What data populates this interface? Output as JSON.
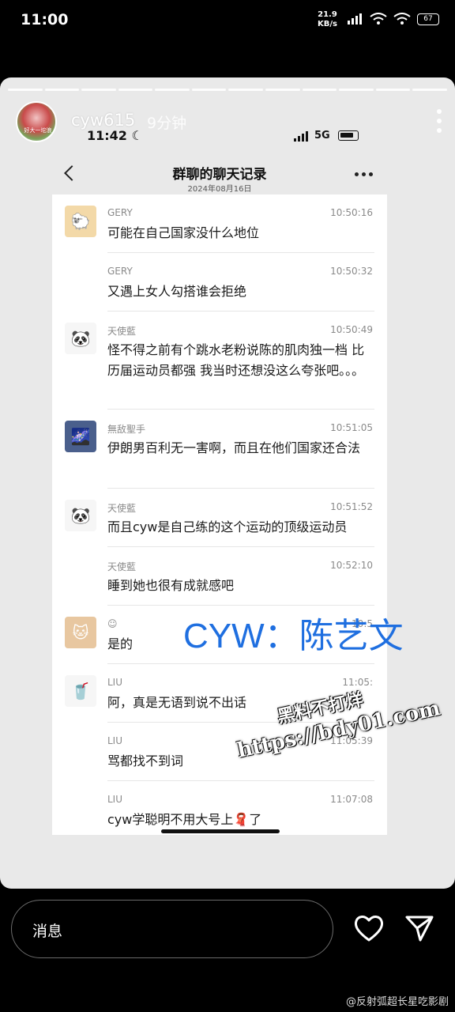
{
  "status_bar": {
    "time": "11:00",
    "speed_value": "21.9",
    "speed_unit": "KB/s",
    "battery": "67"
  },
  "story": {
    "username": "cyw615",
    "posted": "9分钟",
    "avatar_caption": "好大一坨浪"
  },
  "inner_status": {
    "time": "11:42",
    "network": "5G"
  },
  "chat": {
    "title": "群聊的聊天记录",
    "date": "2024年08月16日",
    "messages": [
      {
        "name": "GERY",
        "time": "10:50:16",
        "text": "可能在自己国家没什么地位",
        "avatar": "🐑"
      },
      {
        "name": "GERY",
        "time": "10:50:32",
        "text": "又遇上女人勾搭谁会拒绝",
        "avatar": ""
      },
      {
        "name": "天使藍",
        "time": "10:50:49",
        "text": "怪不得之前有个跳水老粉说陈的肌肉独一档 比历届运动员都强 我当时还想没这么夸张吧。。。",
        "avatar": "🐼"
      },
      {
        "name": "無敌聖手",
        "time": "10:51:05",
        "text": "伊朗男百利无一害啊，而且在他们国家还合法",
        "avatar": "🌌"
      },
      {
        "name": "天使藍",
        "time": "10:51:52",
        "text": "而且cyw是自己练的这个运动的顶级运动员",
        "avatar": "🐼"
      },
      {
        "name": "天使藍",
        "time": "10:52:10",
        "text": "睡到她也很有成就感吧",
        "avatar": ""
      },
      {
        "name": "☺",
        "time": "10:5",
        "text": "是的",
        "avatar": "🐱"
      },
      {
        "name": "LIU",
        "time": "11:05:",
        "text": "阿，真是无语到说不出话",
        "avatar": "🥤"
      },
      {
        "name": "LIU",
        "time": "11:05:39",
        "text": "骂都找不到词",
        "avatar": ""
      },
      {
        "name": "LIU",
        "time": "11:07:08",
        "text": "cyw学聪明不用大号上🧣了",
        "avatar": ""
      }
    ]
  },
  "overlay": {
    "label": "CYW：陈艺文",
    "watermark_line1": "黑料不打烊",
    "watermark_line2": "https://bdy01.com"
  },
  "bottom": {
    "reply_placeholder": "消息",
    "credit": "@反射弧超长星吃影剧"
  },
  "icons": {
    "heart": "heart-icon",
    "send": "send-icon",
    "more": "more-vertical-icon",
    "back": "back-chevron-icon"
  },
  "colors": {
    "overlay_blue": "#1f6fe0",
    "card_bg": "#e9e9e9"
  }
}
